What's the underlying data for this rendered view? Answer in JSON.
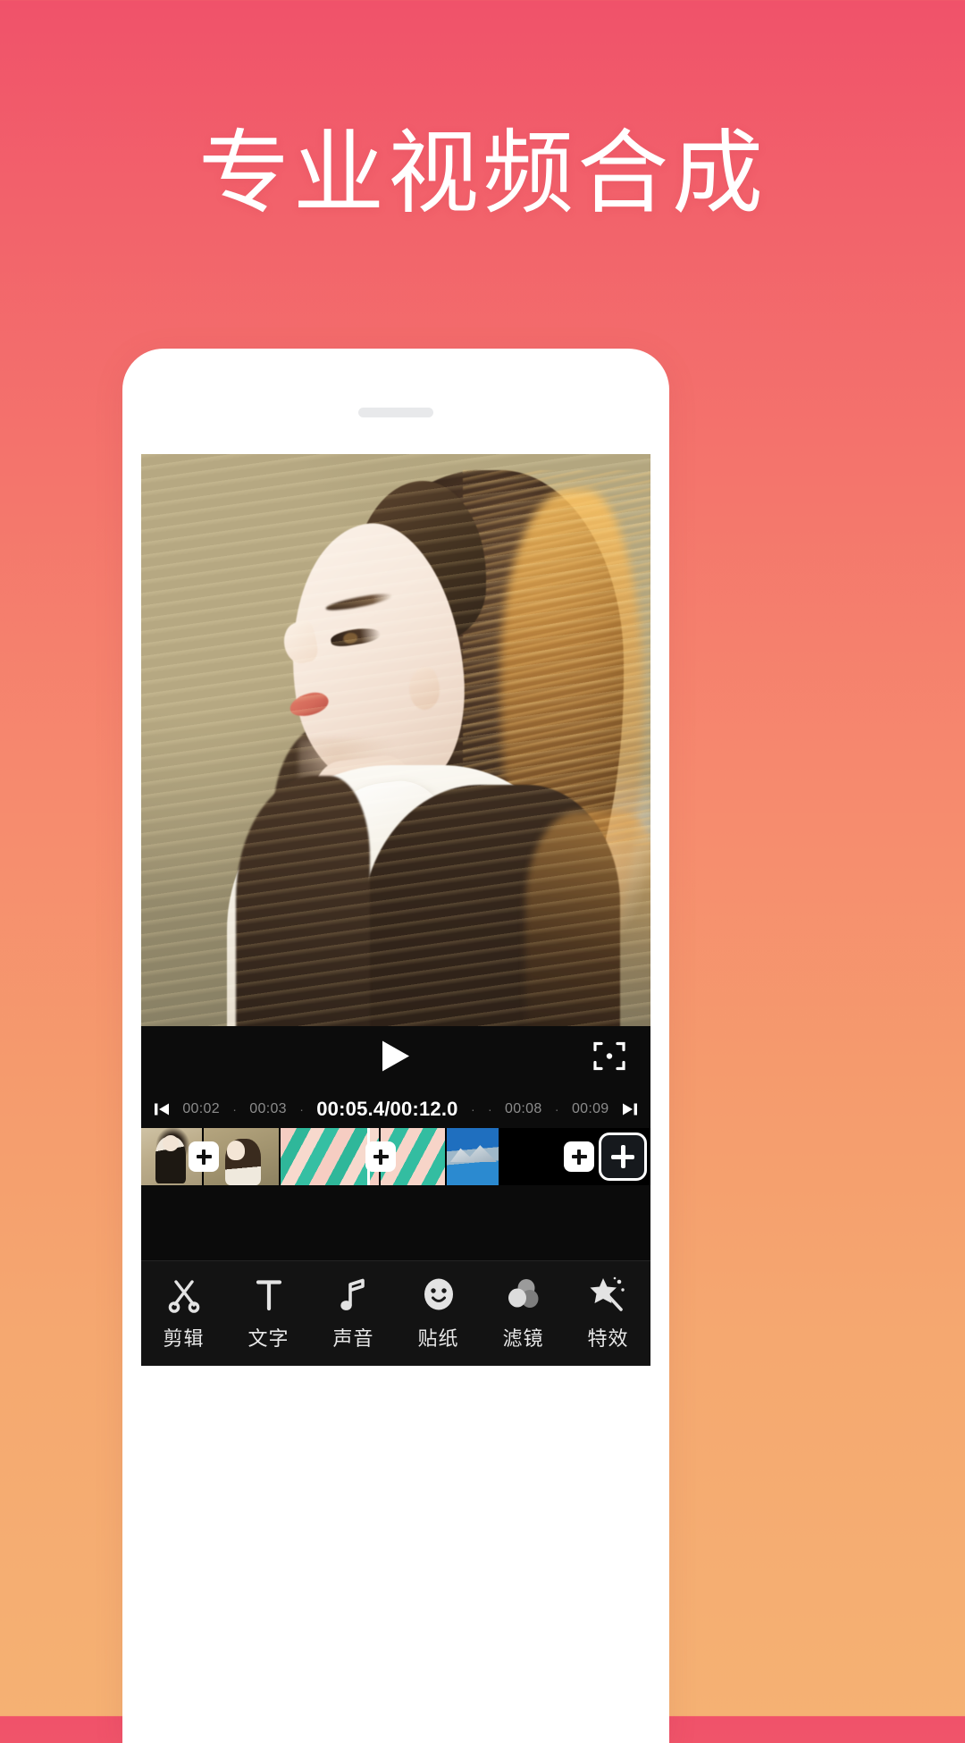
{
  "page": {
    "headline": "专业视频合成",
    "background": {
      "top_color": "#f0526a",
      "bottom_color": "#f5b173"
    }
  },
  "phone": {
    "speaker_name": "speaker-grille"
  },
  "editor": {
    "preview": {
      "alt": "portrait of a woman with long hair in golden sunlight"
    },
    "controls": {
      "play_icon": "play-icon",
      "crop_icon": "crop-frame-icon"
    },
    "ruler": {
      "jump_start_icon": "skip-to-start-icon",
      "jump_end_icon": "skip-to-end-icon",
      "left_ticks": [
        "00:02",
        "00:03"
      ],
      "right_ticks": [
        "00:08",
        "00:09"
      ],
      "dot": "·",
      "current_time": "00:05.4",
      "separator": "/",
      "total_time": "00:12.0",
      "time_display": "00:05.4/00:12.0"
    },
    "timeline": {
      "transition_label": "+",
      "add_clip_label": "+",
      "clips": [
        {
          "name": "clip-1"
        },
        {
          "name": "clip-2"
        },
        {
          "name": "clip-3"
        },
        {
          "name": "clip-4"
        },
        {
          "name": "clip-5"
        }
      ]
    },
    "toolbar": [
      {
        "label": "剪辑",
        "icon": "scissors-icon"
      },
      {
        "label": "文字",
        "icon": "text-t-icon"
      },
      {
        "label": "声音",
        "icon": "music-note-icon"
      },
      {
        "label": "贴纸",
        "icon": "smiley-sticker-icon"
      },
      {
        "label": "滤镜",
        "icon": "filter-circles-icon"
      },
      {
        "label": "特效",
        "icon": "magic-wand-star-icon"
      }
    ]
  }
}
